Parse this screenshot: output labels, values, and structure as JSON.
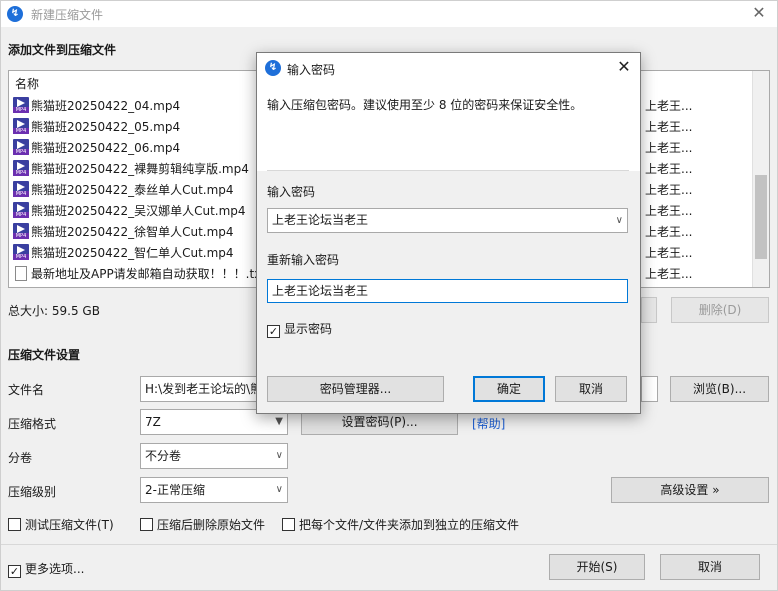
{
  "window": {
    "title": "新建压缩文件",
    "close_glyph": "✕"
  },
  "add_files": {
    "heading": "添加文件到压缩文件",
    "column_name": "名称",
    "files": [
      {
        "name": "熊猫班20250422_04.mp4",
        "icon": "mp4-file-icon",
        "right": "上老王..."
      },
      {
        "name": "熊猫班20250422_05.mp4",
        "icon": "mp4-file-icon",
        "right": "上老王..."
      },
      {
        "name": "熊猫班20250422_06.mp4",
        "icon": "mp4-file-icon",
        "right": "上老王..."
      },
      {
        "name": "熊猫班20250422_裸舞剪辑纯享版.mp4",
        "icon": "mp4-file-icon",
        "right": "上老王..."
      },
      {
        "name": "熊猫班20250422_泰丝单人Cut.mp4",
        "icon": "mp4-file-icon",
        "right": "上老王..."
      },
      {
        "name": "熊猫班20250422_吴汉娜单人Cut.mp4",
        "icon": "mp4-file-icon",
        "right": "上老王..."
      },
      {
        "name": "熊猫班20250422_徐智单人Cut.mp4",
        "icon": "mp4-file-icon",
        "right": "上老王..."
      },
      {
        "name": "熊猫班20250422_智仁单人Cut.mp4",
        "icon": "mp4-file-icon",
        "right": "上老王..."
      },
      {
        "name": "最新地址及APP请发邮箱自动获取！！！.txt",
        "icon": "txt-file-icon",
        "right": "上老王..."
      }
    ],
    "total_size": "总大小: 59.5 GB",
    "delete_label": "删除(D)"
  },
  "settings": {
    "heading": "压缩文件设置",
    "filename_label": "文件名",
    "filename_value": "H:\\发到老王论坛的\\熊",
    "browse_label": "浏览(B)...",
    "format_label": "压缩格式",
    "format_value": "7Z",
    "set_password_label": "设置密码(P)...",
    "help_label": "[帮助]",
    "split_label": "分卷",
    "split_value": "不分卷",
    "level_label": "压缩级别",
    "level_value": "2-正常压缩",
    "advanced_label": "高级设置 »",
    "test_label": "测试压缩文件(T)",
    "delete_after_label": "压缩后删除原始文件",
    "separate_label": "把每个文件/文件夹添加到独立的压缩文件"
  },
  "footer": {
    "more_options_label": "更多选项...",
    "more_options_checked": true,
    "start_label": "开始(S)",
    "cancel_label": "取消"
  },
  "dialog": {
    "title": "输入密码",
    "close_glyph": "✕",
    "description": "输入压缩包密码。建议使用至少 8 位的密码来保证安全性。",
    "password_label": "输入密码",
    "password_value": "上老王论坛当老王",
    "reenter_label": "重新输入密码",
    "reenter_value": "上老王论坛当老王",
    "show_password_label": "显示密码",
    "show_password_checked": true,
    "manager_label": "密码管理器...",
    "ok_label": "确定",
    "cancel_label": "取消"
  },
  "colors": {
    "accent": "#0078d7",
    "link": "#1e5fd2",
    "app_icon": "#1e6fd9"
  }
}
